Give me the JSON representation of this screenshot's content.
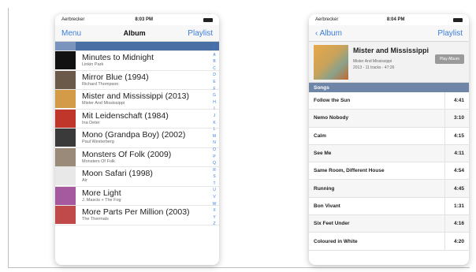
{
  "left": {
    "status": {
      "carrier": "Aerbrecker",
      "time": "8:03 PM"
    },
    "nav": {
      "left": "Menu",
      "title": "Album",
      "right": "Playlist"
    },
    "selected_letter": "M",
    "rows": [
      {
        "title": "Minutes to Midnight",
        "artist": "Linkin Park",
        "color": "#111111"
      },
      {
        "title": "Mirror Blue (1994)",
        "artist": "Richard Thompson",
        "color": "#6b5a4a"
      },
      {
        "title": "Mister and Mississippi (2013)",
        "artist": "Mister And Mississippi",
        "color": "#d39a47"
      },
      {
        "title": "Mit Leidenschaft (1984)",
        "artist": "Ina Deter",
        "color": "#c1362b"
      },
      {
        "title": "Mono (Grandpa Boy) (2002)",
        "artist": "Paul Westerberg",
        "color": "#3a3a3a"
      },
      {
        "title": "Monsters Of Folk (2009)",
        "artist": "Monsters Of Folk",
        "color": "#9a8a7a"
      },
      {
        "title": "Moon Safari (1998)",
        "artist": "Air",
        "color": "#e8e8e8"
      },
      {
        "title": "More Light",
        "artist": "J. Mascis + The Fog",
        "color": "#a55aa0"
      },
      {
        "title": "More Parts Per Million (2003)",
        "artist": "The Thermals",
        "color": "#c04a4a"
      }
    ],
    "index": [
      "Q",
      "A",
      "B",
      "C",
      "D",
      "E",
      "F",
      "G",
      "H",
      "I",
      "J",
      "K",
      "L",
      "M",
      "N",
      "O",
      "P",
      "Q",
      "R",
      "S",
      "T",
      "U",
      "V",
      "W",
      "X",
      "Y",
      "Z"
    ]
  },
  "right": {
    "status": {
      "carrier": "Aerbrecker",
      "time": "8:04 PM"
    },
    "nav": {
      "back": "Album",
      "right": "Playlist"
    },
    "album": {
      "title": "Mister and Mississippi",
      "artist": "Mister And Mississippi",
      "meta": "2013 - 11 tracks - 47:26",
      "play": "Play Album"
    },
    "section": "Songs",
    "tracks": [
      {
        "title": "Follow the Sun",
        "duration": "4:41"
      },
      {
        "title": "Nemo Nobody",
        "duration": "3:10"
      },
      {
        "title": "Calm",
        "duration": "4:15"
      },
      {
        "title": "See Me",
        "duration": "4:11"
      },
      {
        "title": "Same Room, Different House",
        "duration": "4:54"
      },
      {
        "title": "Running",
        "duration": "4:45"
      },
      {
        "title": "Bon Vivant",
        "duration": "1:31"
      },
      {
        "title": "Six Feet Under",
        "duration": "4:16"
      },
      {
        "title": "Coloured in White",
        "duration": "4:20"
      }
    ]
  },
  "colors": {
    "accent": "#3b7ddc",
    "selected": "#4a6fa5",
    "section": "#6f85a8"
  }
}
